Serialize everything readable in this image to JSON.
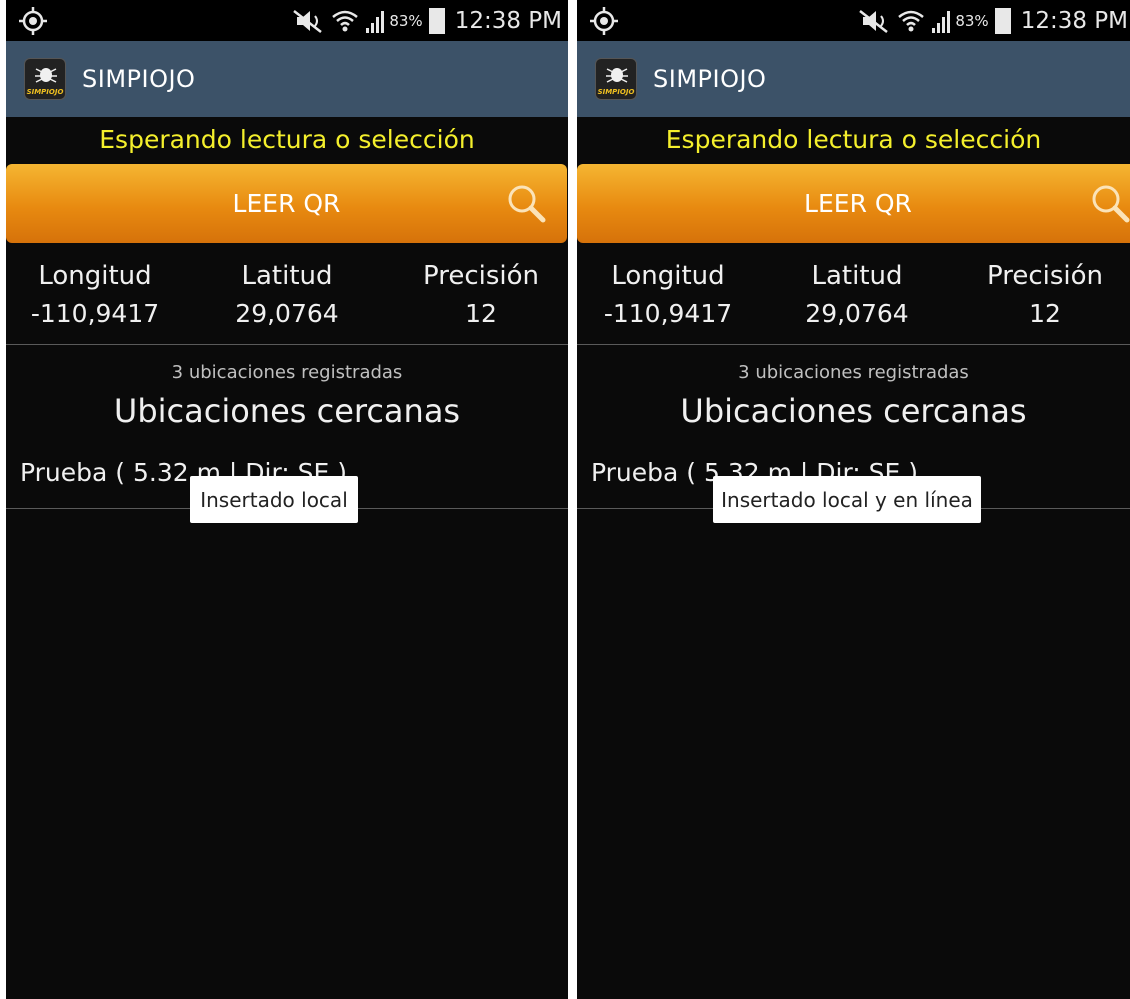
{
  "status_bar": {
    "battery_percent": "83%",
    "time": "12:38 PM"
  },
  "app": {
    "title": "SIMPIOJO",
    "icon_text": "SIMPIOJO"
  },
  "status_message": "Esperando lectura o selección",
  "qr_button": {
    "label": "LEER QR"
  },
  "coordinates": {
    "longitude": {
      "label": "Longitud",
      "value": "-110,9417"
    },
    "latitude": {
      "label": "Latitud",
      "value": "29,0764"
    },
    "precision": {
      "label": "Precisión",
      "value": "12"
    }
  },
  "registered_count": "3 ubicaciones registradas",
  "nearby_title": "Ubicaciones cercanas",
  "nearby_items": [
    {
      "text": "Prueba ( 5.32 m | Dir: SE )"
    }
  ],
  "toasts": {
    "left": "Insertado local",
    "right": "Insertado local y en línea"
  },
  "colors": {
    "action_bar": "#3c5268",
    "status_message": "#f4ef2c",
    "button": "#e88a10",
    "background": "#0a0a0a"
  }
}
